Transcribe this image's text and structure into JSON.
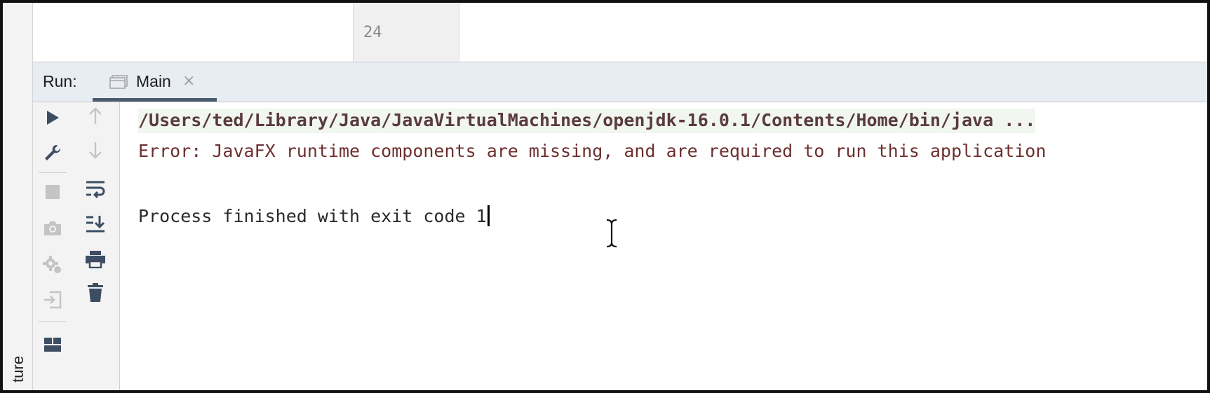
{
  "side_panel": {
    "label": "ture"
  },
  "editor": {
    "line_number": "24"
  },
  "run_panel": {
    "label": "Run:",
    "tab": {
      "label": "Main",
      "close": "×",
      "icon": "window-icon"
    }
  },
  "toolbar_left": {
    "items": [
      {
        "name": "run-icon",
        "enabled": true
      },
      {
        "name": "wrench-icon",
        "enabled": true
      },
      {
        "name": "stop-icon",
        "enabled": false
      },
      {
        "name": "camera-icon",
        "enabled": false
      },
      {
        "name": "debug-gear-icon",
        "enabled": false
      },
      {
        "name": "exit-icon",
        "enabled": false
      },
      {
        "name": "layout-icon",
        "enabled": true
      }
    ]
  },
  "toolbar_right": {
    "items": [
      {
        "name": "arrow-up-icon",
        "enabled": false
      },
      {
        "name": "arrow-down-icon",
        "enabled": false
      },
      {
        "name": "soft-wrap-icon",
        "enabled": true
      },
      {
        "name": "scroll-to-end-icon",
        "enabled": true
      },
      {
        "name": "print-icon",
        "enabled": true
      },
      {
        "name": "trash-icon",
        "enabled": true
      }
    ]
  },
  "console": {
    "command_line": "/Users/ted/Library/Java/JavaVirtualMachines/openjdk-16.0.1/Contents/Home/bin/java ...",
    "error_line": "Error: JavaFX runtime components are missing, and are required to run this application",
    "finish_line": "Process finished with exit code 1"
  },
  "colors": {
    "run_bar_bg": "#e8ecf3",
    "tab_underline": "#4a5b70",
    "error_text": "#6e2f2f",
    "toolbar_icon": "#3d4d63",
    "disabled_icon": "#b9b9b9"
  }
}
